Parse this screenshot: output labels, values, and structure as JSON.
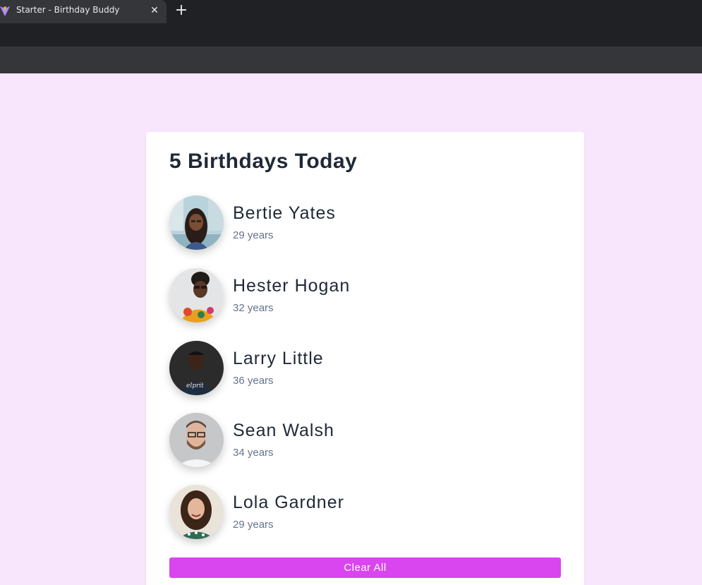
{
  "browser": {
    "tab_title": "Starter - Birthday Buddy",
    "close_glyph": "✕",
    "new_tab_glyph": "+"
  },
  "card": {
    "title": "5 Birthdays Today",
    "clear_label": "Clear All",
    "accent_color": "#d946ef"
  },
  "people": [
    {
      "name": "Bertie Yates",
      "age": "29 years",
      "avatar_icon": "woman-glasses-city-avatar"
    },
    {
      "name": "Hester Hogan",
      "age": "32 years",
      "avatar_icon": "woman-glasses-floral-avatar"
    },
    {
      "name": "Larry Little",
      "age": "36 years",
      "avatar_icon": "man-dark-shirt-avatar"
    },
    {
      "name": "Sean Walsh",
      "age": "34 years",
      "avatar_icon": "man-glasses-beard-avatar"
    },
    {
      "name": "Lola Gardner",
      "age": "29 years",
      "avatar_icon": "woman-curly-hair-avatar"
    }
  ]
}
